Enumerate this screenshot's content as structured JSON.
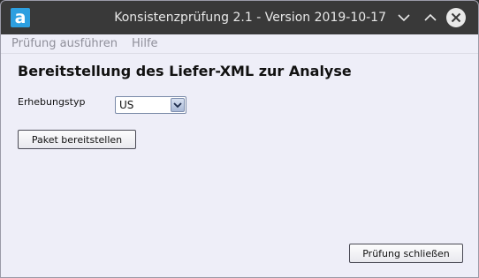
{
  "window": {
    "title": "Konsistenzprüfung 2.1 - Version 2019-10-17",
    "app_icon_letter": "a",
    "app_icon_color": "#2d9fe0",
    "titlebar_color": "#393939"
  },
  "menu": {
    "items": [
      {
        "label": "Prüfung ausführen"
      },
      {
        "label": "Hilfe"
      }
    ]
  },
  "main": {
    "heading": "Bereitstellung des Liefer-XML zur Analyse",
    "erhebungstyp_label": "Erhebungstyp",
    "erhebungstyp_value": "US",
    "paket_button_label": "Paket bereitstellen",
    "close_button_label": "Prüfung schließen"
  },
  "icons": {
    "minimize": "chevron-down-icon",
    "maximize": "chevron-up-icon",
    "close": "close-circle-icon",
    "dropdown": "dropdown-arrow-icon"
  }
}
